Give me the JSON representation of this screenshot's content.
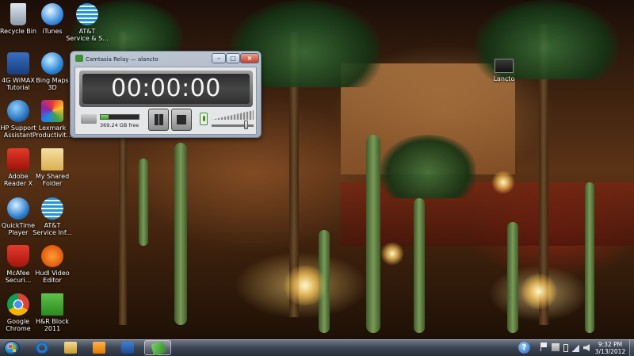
{
  "desktop": {
    "icons": [
      {
        "id": "recycle-bin",
        "label": "Recycle Bin",
        "icon": "recycle-bin-icon"
      },
      {
        "id": "itunes",
        "label": "iTunes",
        "icon": "itunes-icon"
      },
      {
        "id": "att-service",
        "label": "AT&T\nService & S...",
        "icon": "att-icon"
      },
      {
        "id": "4g-wimax",
        "label": "4G WiMAX\nTutorial",
        "icon": "wimax-icon"
      },
      {
        "id": "bing-maps",
        "label": "Bing Maps\n3D",
        "icon": "bing-maps-icon"
      },
      {
        "id": "hp-support",
        "label": "HP Support\nAssistant",
        "icon": "hp-support-icon"
      },
      {
        "id": "lexmark",
        "label": "Lexmark\nProductivit...",
        "icon": "lexmark-icon"
      },
      {
        "id": "adobe-reader",
        "label": "Adobe\nReader X",
        "icon": "adobe-reader-icon"
      },
      {
        "id": "my-shared",
        "label": "My Shared\nFolder",
        "icon": "folder-icon"
      },
      {
        "id": "quicktime",
        "label": "QuickTime\nPlayer",
        "icon": "quicktime-icon"
      },
      {
        "id": "att-service-info",
        "label": "AT&T\nService Inf...",
        "icon": "att-icon"
      },
      {
        "id": "mcafee",
        "label": "McAfee\nSecuri...",
        "icon": "mcafee-icon"
      },
      {
        "id": "hudl",
        "label": "Hudl Video\nEditor",
        "icon": "hudl-icon"
      },
      {
        "id": "chrome",
        "label": "Google\nChrome",
        "icon": "chrome-icon"
      },
      {
        "id": "hr-block",
        "label": "H&R Block\n2011",
        "icon": "hr-block-icon"
      },
      {
        "id": "lancto",
        "label": "Lancto",
        "icon": "video-file-icon"
      }
    ]
  },
  "recorder": {
    "title": "Camtasia Relay — alancto",
    "timer": "00:00:00",
    "disk_free": "369.24 GB free",
    "disk_fill_fraction": 0.2,
    "volume_fraction": 0.85,
    "buttons": {
      "minimize": "–",
      "maximize": "□",
      "close": "×"
    }
  },
  "taskbar": {
    "pinned": [
      {
        "id": "ie",
        "icon": "internet-explorer-icon"
      },
      {
        "id": "explorer",
        "icon": "file-explorer-icon"
      },
      {
        "id": "media-player",
        "icon": "media-player-icon"
      },
      {
        "id": "task-app",
        "icon": "checkmark-app-icon"
      },
      {
        "id": "camtasia",
        "icon": "camtasia-relay-icon"
      }
    ],
    "clock": {
      "time": "9:32 PM",
      "date": "3/13/2012"
    },
    "help_glyph": "?"
  }
}
